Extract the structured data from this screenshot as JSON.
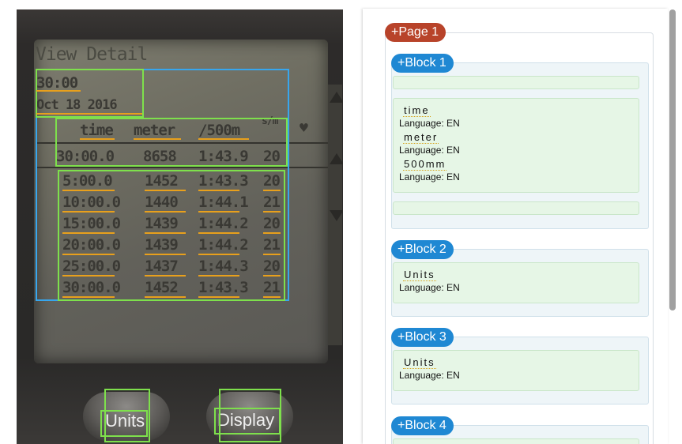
{
  "photo": {
    "lcd_title": "View Detail",
    "time_header": "30:00",
    "date_header": "Oct  18 2016",
    "columns": [
      "time",
      "meter",
      "/500m",
      "s/m"
    ],
    "total_row": [
      "30:00.0",
      "8658",
      "1:43.9",
      "20"
    ],
    "rows": [
      [
        "5:00.0",
        "1452",
        "1:43.3",
        "20"
      ],
      [
        "10:00.0",
        "1440",
        "1:44.1",
        "21"
      ],
      [
        "15:00.0",
        "1439",
        "1:44.2",
        "20"
      ],
      [
        "20:00.0",
        "1439",
        "1:44.2",
        "21"
      ],
      [
        "25:00.0",
        "1437",
        "1:44.3",
        "20"
      ],
      [
        "30:00.0",
        "1452",
        "1:43.3",
        "21"
      ]
    ],
    "button_units": "Units",
    "button_display": "Display"
  },
  "panel": {
    "page_label": "+Page 1",
    "blocks": [
      {
        "label": "+Block 1",
        "entries": [
          {
            "word": "time",
            "lang": "Language: EN"
          },
          {
            "word": "meter",
            "lang": "Language: EN"
          },
          {
            "word": "500mm",
            "lang": "Language: EN"
          }
        ]
      },
      {
        "label": "+Block 2",
        "entries": [
          {
            "word": "Units",
            "lang": "Language: EN"
          }
        ]
      },
      {
        "label": "+Block 3",
        "entries": [
          {
            "word": "Units",
            "lang": "Language: EN"
          }
        ]
      },
      {
        "label": "+Block 4",
        "entries": []
      }
    ]
  },
  "colors": {
    "page_pill": "#b8432a",
    "block_pill": "#1f88d3",
    "ocr_box_green": "#7ee04c",
    "ocr_box_blue": "#37a6ee",
    "word_underline": "#d6a21a"
  }
}
